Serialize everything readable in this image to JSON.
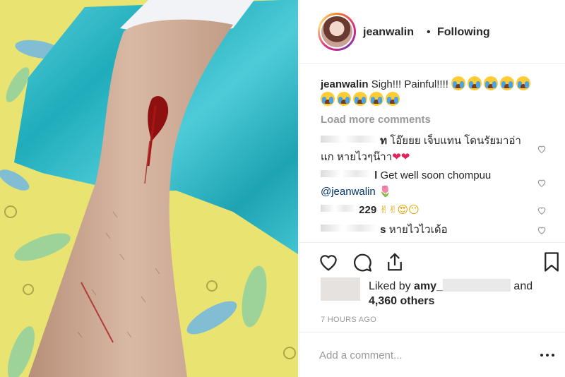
{
  "post": {
    "image_alt": "arm-wound-photo"
  },
  "header": {
    "username": "jeanwalin",
    "separator": "•",
    "follow_status": "Following"
  },
  "caption": {
    "username": "jeanwalin",
    "text": "Sigh!!! Painful!!!!",
    "emoji_count": 10
  },
  "comments_section": {
    "load_more": "Load more comments",
    "comments": [
      {
        "user_visible": "ท",
        "line1": "โอ๊ยยย เจ็บแทน โดนรัยมาอ่า",
        "line2": "แก หายไวๆน๊าา",
        "emoji": "❤❤"
      },
      {
        "user_visible": "l",
        "line1": "Get well soon chompuu",
        "mention": "@jeanwalin",
        "emoji": "🌷"
      },
      {
        "user_visible": "229",
        "line1": "",
        "emoji": "✌✌😍😶"
      },
      {
        "user_visible": "s",
        "line1": "หายไวไวเด้อ"
      }
    ]
  },
  "likes": {
    "prefix": "Liked by",
    "user": "amy_",
    "and": "and",
    "others": "4,360 others"
  },
  "timestamp": "7 HOURS AGO",
  "add_comment": {
    "placeholder": "Add a comment..."
  },
  "icons": [
    "heart-icon",
    "comment-icon",
    "share-icon",
    "bookmark-icon",
    "more-options-icon"
  ]
}
